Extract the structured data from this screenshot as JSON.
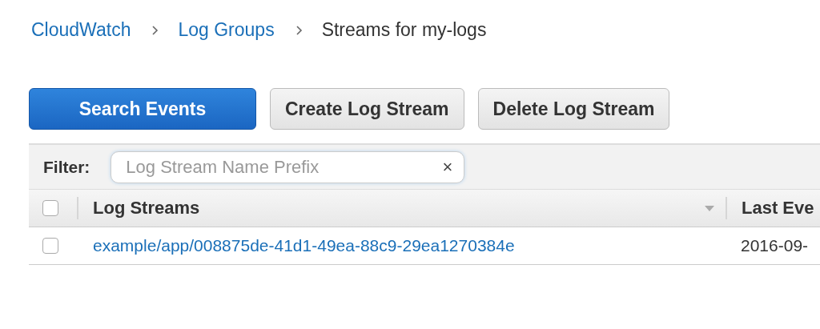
{
  "breadcrumb": [
    {
      "label": "CloudWatch",
      "link": true
    },
    {
      "label": "Log Groups",
      "link": true
    },
    {
      "label": "Streams for my-logs",
      "link": false
    }
  ],
  "buttons": [
    {
      "label": "Search Events",
      "kind": "primary"
    },
    {
      "label": "Create Log Stream",
      "kind": "secondary"
    },
    {
      "label": "Delete Log Stream",
      "kind": "secondary"
    }
  ],
  "filter": {
    "label": "Filter:",
    "placeholder": "Log Stream Name Prefix",
    "clear": "×"
  },
  "table": {
    "select_all": {
      "checked": false
    },
    "columns": [
      "Log Streams",
      "Last Eve"
    ],
    "rows": [
      {
        "checked": false,
        "cells": [
          "example/app/008875de-41d1-49ea-88c9-29ea1270384e",
          "2016-09-"
        ]
      }
    ]
  }
}
